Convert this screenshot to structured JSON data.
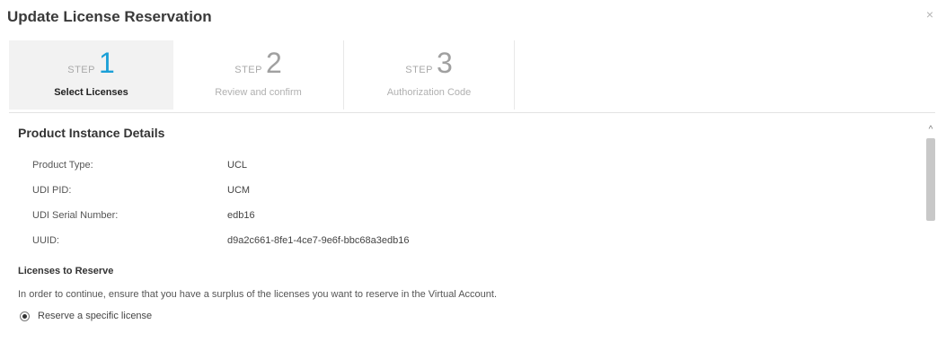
{
  "modal": {
    "title": "Update License Reservation",
    "close_glyph": "×"
  },
  "steps": [
    {
      "word": "STEP",
      "number": "1",
      "label": "Select Licenses",
      "active": true
    },
    {
      "word": "STEP",
      "number": "2",
      "label": "Review and confirm",
      "active": false
    },
    {
      "word": "STEP",
      "number": "3",
      "label": "Authorization Code",
      "active": false
    }
  ],
  "details": {
    "title": "Product Instance Details",
    "rows": [
      {
        "label": "Product Type:",
        "value": "UCL"
      },
      {
        "label": "UDI PID:",
        "value": "UCM"
      },
      {
        "label": "UDI Serial Number:",
        "value": "edb16"
      },
      {
        "label": "UUID:",
        "value": "d9a2c661-8fe1-4ce7-9e6f-bbc68a3edb16"
      }
    ]
  },
  "licenses": {
    "heading": "Licenses to Reserve",
    "help": "In order to continue, ensure that you have a surplus of the licenses you want to reserve in the Virtual Account.",
    "option_label": "Reserve a specific license",
    "option_selected": true
  },
  "scroll": {
    "up_glyph": "^"
  },
  "colors": {
    "accent": "#1ba0d7",
    "active_step_bg": "#f2f2f2"
  }
}
